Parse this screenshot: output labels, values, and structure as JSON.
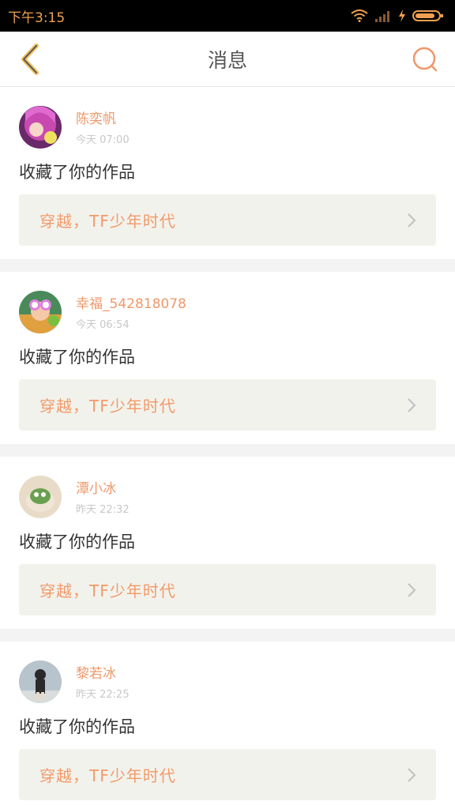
{
  "status_bar": {
    "time": "下午3:15"
  },
  "nav": {
    "title": "消息",
    "back_icon": "chevron-left-icon",
    "search_icon": "search-icon"
  },
  "colors": {
    "accent": "#f0986a",
    "status_bg": "#000000",
    "card_link_bg": "#f2f2ec"
  },
  "messages": [
    {
      "username": "陈奕帆",
      "time": "今天 07:00",
      "action": "收藏了你的作品",
      "work_title": "穿越，TF少年时代"
    },
    {
      "username": "幸福_542818078",
      "time": "今天 06:54",
      "action": "收藏了你的作品",
      "work_title": "穿越，TF少年时代"
    },
    {
      "username": "潭小冰",
      "time": "昨天 22:32",
      "action": "收藏了你的作品",
      "work_title": "穿越，TF少年时代"
    },
    {
      "username": "黎若冰",
      "time": "昨天 22:25",
      "action": "收藏了你的作品",
      "work_title": "穿越，TF少年时代"
    }
  ]
}
